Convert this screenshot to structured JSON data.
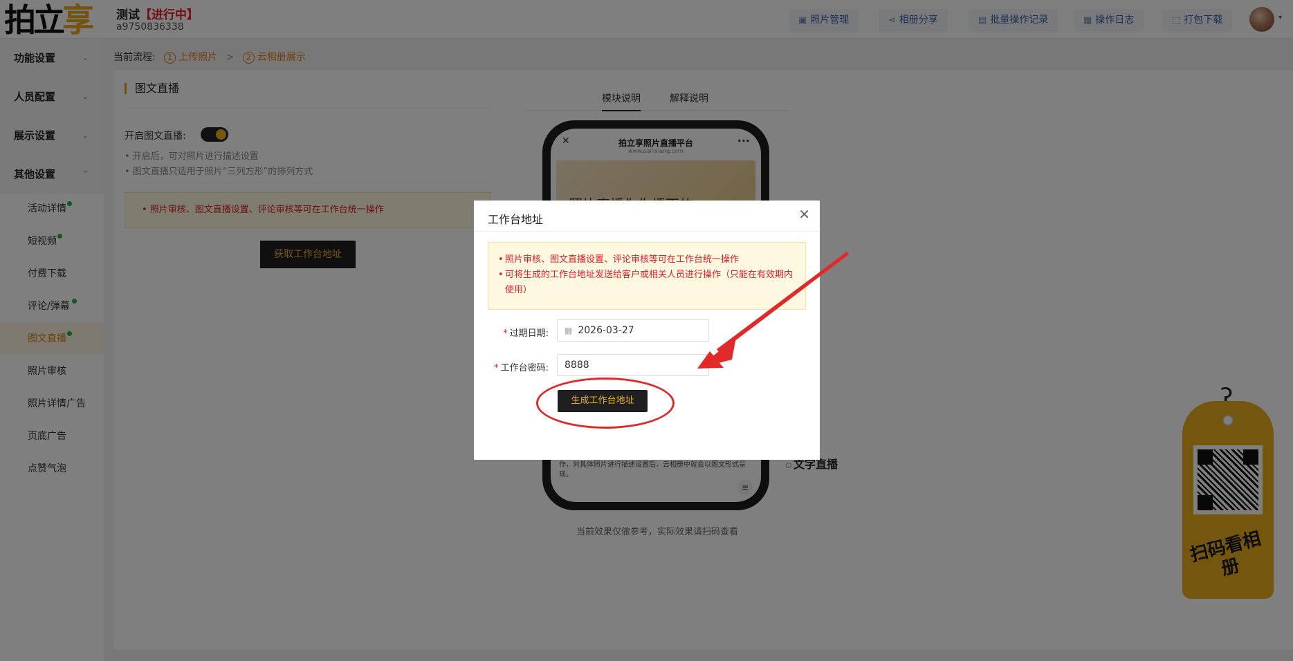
{
  "header": {
    "logo_main": "拍立",
    "logo_accent": "享",
    "event_name": "测试",
    "event_status": "【进行中】",
    "event_id": "a9750836338",
    "buttons": [
      {
        "label": "照片管理",
        "icon": "photo-icon"
      },
      {
        "label": "相册分享",
        "icon": "share-icon"
      },
      {
        "label": "批量操作记录",
        "icon": "batch-record-icon"
      },
      {
        "label": "操作日志",
        "icon": "log-icon"
      },
      {
        "label": "打包下载",
        "icon": "package-download-icon"
      }
    ]
  },
  "sidebar": {
    "sections": [
      {
        "label": "功能设置",
        "expanded": false
      },
      {
        "label": "人员配置",
        "expanded": false
      },
      {
        "label": "展示设置",
        "expanded": false
      },
      {
        "label": "其他设置",
        "expanded": true
      }
    ],
    "items": [
      {
        "label": "活动详情",
        "dot": true
      },
      {
        "label": "短视频",
        "dot": true
      },
      {
        "label": "付费下载",
        "dot": false
      },
      {
        "label": "评论/弹幕",
        "dot": true
      },
      {
        "label": "图文直播",
        "dot": true,
        "active": true
      },
      {
        "label": "照片审核",
        "dot": false
      },
      {
        "label": "照片详情广告",
        "dot": false
      },
      {
        "label": "页底广告",
        "dot": false
      },
      {
        "label": "点赞气泡",
        "dot": false
      }
    ]
  },
  "flow": {
    "label": "当前流程:",
    "steps": [
      {
        "num": "1",
        "label": "上传照片"
      },
      {
        "num": "2",
        "label": "云相册展示"
      }
    ],
    "separator": ">"
  },
  "main": {
    "section_title": "图文直播",
    "toggle_label": "开启图文直播:",
    "toggle_on": true,
    "hints": [
      "• 开启后，可对照片进行描述设置",
      "• 图文直播只适用于照片“三列方形”的排列方式"
    ],
    "notice": "• 照片审核、图文直播设置、评论审核等可在工作台统一操作",
    "get_address_button": "获取工作台地址",
    "tabs": [
      "模块说明",
      "解释说明"
    ],
    "phone": {
      "title": "拍立享照片直播平台",
      "subtitle": "www.pailixiang.com",
      "banner_text": "照片直播为你播下的",
      "body_text": "图片、文字相结合，实时播报活动现场。相册创建者可将编辑链接发给指定人员，由其在电脑端操作，也可通过微信端便捷操作，对具体照片进行描述设置后，云相册中就会以图文形式呈现。"
    },
    "side_label": "文字直播",
    "caption": "当前效果仅做参考，实际效果请扫码查看"
  },
  "tag": {
    "text": "扫码看相册"
  },
  "modal": {
    "title": "工作台地址",
    "notices": [
      "照片审核、图文直播设置、评论审核等可在工作台统一操作",
      "可将生成的工作台地址发送给客户或相关人员进行操作（只能在有效期内使用）"
    ],
    "bullet": "•",
    "expiry_label": "过期日期:",
    "expiry_value": "2026-03-27",
    "password_label": "工作台密码:",
    "password_value": "8888",
    "generate_button": "生成工作台地址"
  },
  "colors": {
    "accent": "#e7a61b",
    "danger": "#e0202a",
    "dark_button": "#1f1f1f",
    "annotation": "#e02a2a"
  }
}
